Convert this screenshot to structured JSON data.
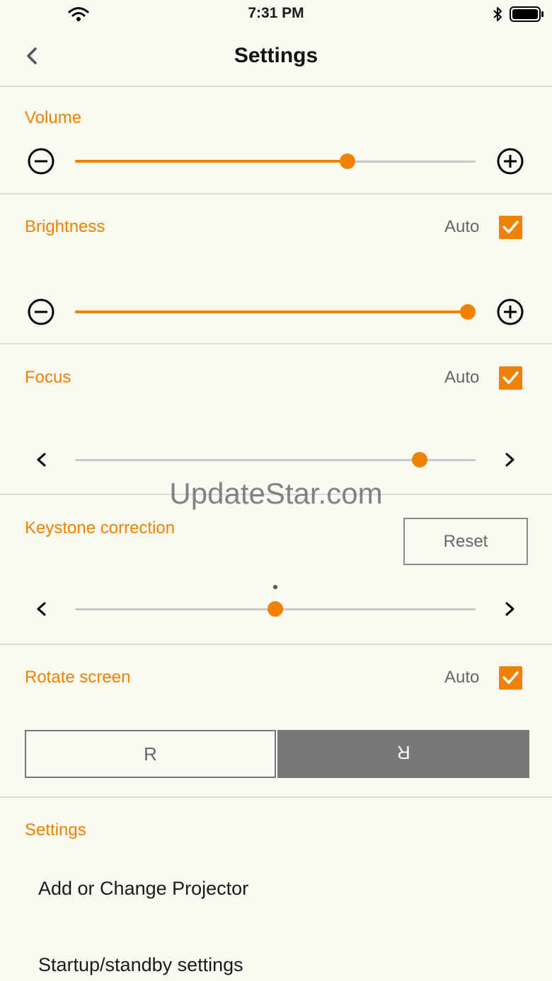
{
  "status": {
    "time": "7:31 PM"
  },
  "nav": {
    "title": "Settings"
  },
  "volume": {
    "label": "Volume",
    "level_percent": 68
  },
  "brightness": {
    "label": "Brightness",
    "auto_label": "Auto",
    "auto_checked": true,
    "level_percent": 98
  },
  "focus": {
    "label": "Focus",
    "auto_label": "Auto",
    "auto_checked": true,
    "level_percent": 86
  },
  "keystone": {
    "label": "Keystone correction",
    "reset_label": "Reset",
    "level_percent": 50
  },
  "rotate": {
    "label": "Rotate screen",
    "auto_label": "Auto",
    "auto_checked": true,
    "normal_label": "R",
    "flipped_label": "R",
    "selected": "flipped"
  },
  "settings": {
    "title": "Settings",
    "items": [
      {
        "label": "Add or Change Projector"
      },
      {
        "label": "Startup/standby settings"
      }
    ]
  },
  "watermark": "UpdateStar.com",
  "colors": {
    "accent": "#ef8200",
    "background": "#fafaf3",
    "divider": "#dcdcd6",
    "selected_segment": "#777777"
  },
  "icons": [
    "wifi-icon",
    "bluetooth-icon",
    "battery-icon",
    "back-chevron-icon",
    "minus-circle-icon",
    "plus-circle-icon",
    "chevron-left-icon",
    "chevron-right-icon",
    "checkmark-icon"
  ]
}
